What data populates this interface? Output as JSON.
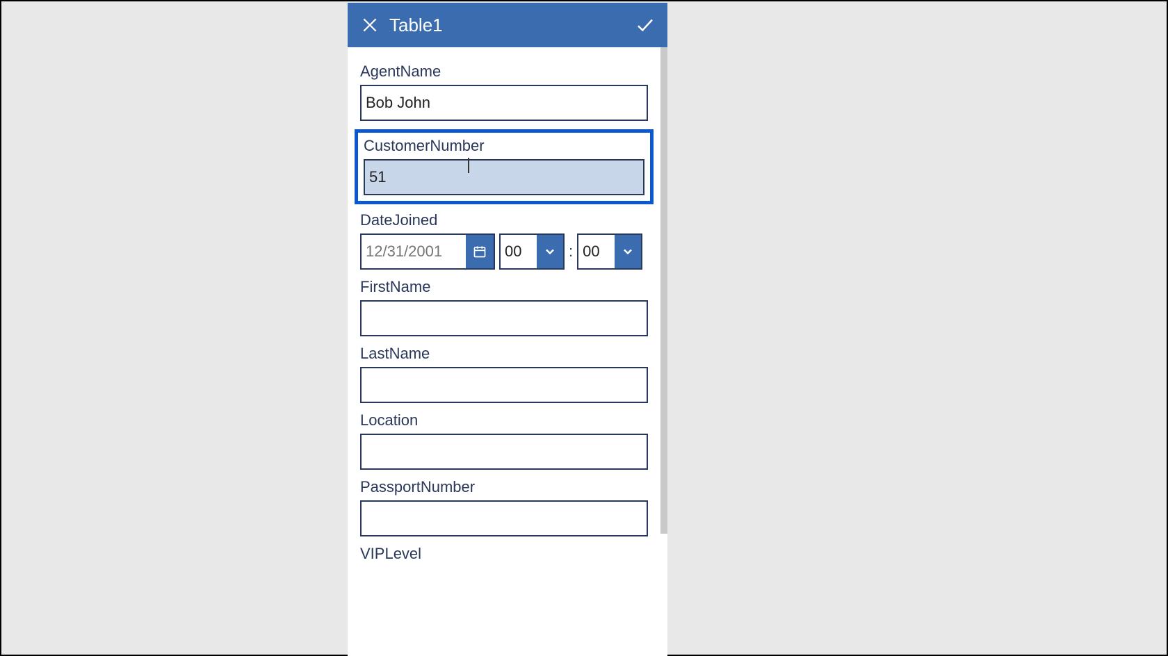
{
  "header": {
    "title": "Table1"
  },
  "form": {
    "agentName": {
      "label": "AgentName",
      "value": "Bob John"
    },
    "customerNumber": {
      "label": "CustomerNumber",
      "value": "51"
    },
    "dateJoined": {
      "label": "DateJoined",
      "placeholder": "12/31/2001",
      "hour": "00",
      "minute": "00",
      "separator": ":"
    },
    "firstName": {
      "label": "FirstName",
      "value": ""
    },
    "lastName": {
      "label": "LastName",
      "value": ""
    },
    "location": {
      "label": "Location",
      "value": ""
    },
    "passportNumber": {
      "label": "PassportNumber",
      "value": ""
    },
    "vipLevel": {
      "label": "VIPLevel",
      "value": ""
    }
  }
}
